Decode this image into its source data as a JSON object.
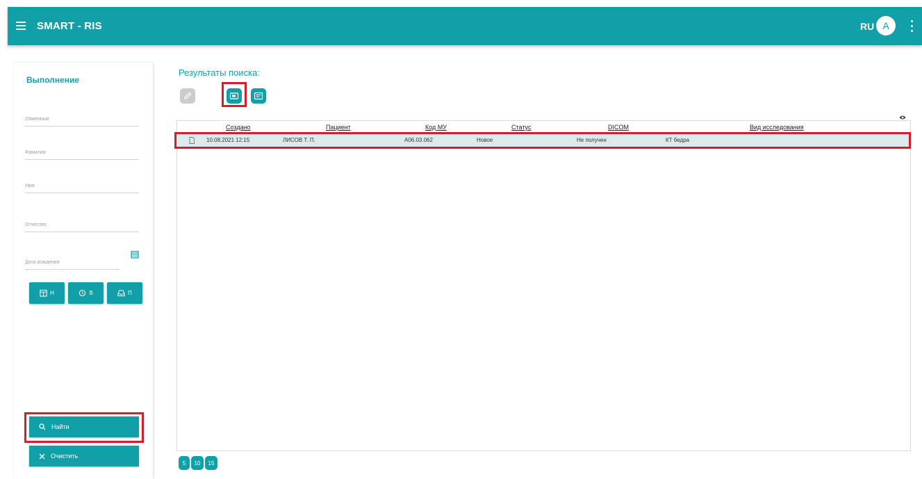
{
  "app": {
    "title": "SMART - RIS",
    "language": "RU",
    "avatar_letter": "A"
  },
  "sidebar": {
    "title": "Выполнение",
    "fields": [
      {
        "placeholder": "Обменный"
      },
      {
        "placeholder": "Фамилия"
      },
      {
        "placeholder": "Имя"
      },
      {
        "placeholder": "Отчество"
      },
      {
        "placeholder": "Дата рождения"
      }
    ],
    "mini_buttons": [
      {
        "label": "Н",
        "icon": "calendar-icon"
      },
      {
        "label": "В",
        "icon": "history-icon"
      },
      {
        "label": "П",
        "icon": "inbox-icon"
      }
    ],
    "find_label": "Найти",
    "clear_label": "Очистить"
  },
  "results": {
    "title": "Результаты поиска:",
    "columns": [
      "Создано",
      "Пациент",
      "Код МУ",
      "Статус",
      "DICOM",
      "Вид исследования"
    ],
    "rows": [
      {
        "created": "10.08.2021 12:15",
        "patient": "ЛИСОВ Т. П.",
        "code": "A06.03.062",
        "status": "Новое",
        "dicom": "Не получен",
        "study": "КТ бедра"
      }
    ]
  },
  "pagination": [
    "5",
    "10",
    "15"
  ],
  "colors": {
    "primary": "#119fa8",
    "highlight": "#d71d2a",
    "row_bg": "#dde9ea",
    "disabled": "#c9cdcf"
  }
}
